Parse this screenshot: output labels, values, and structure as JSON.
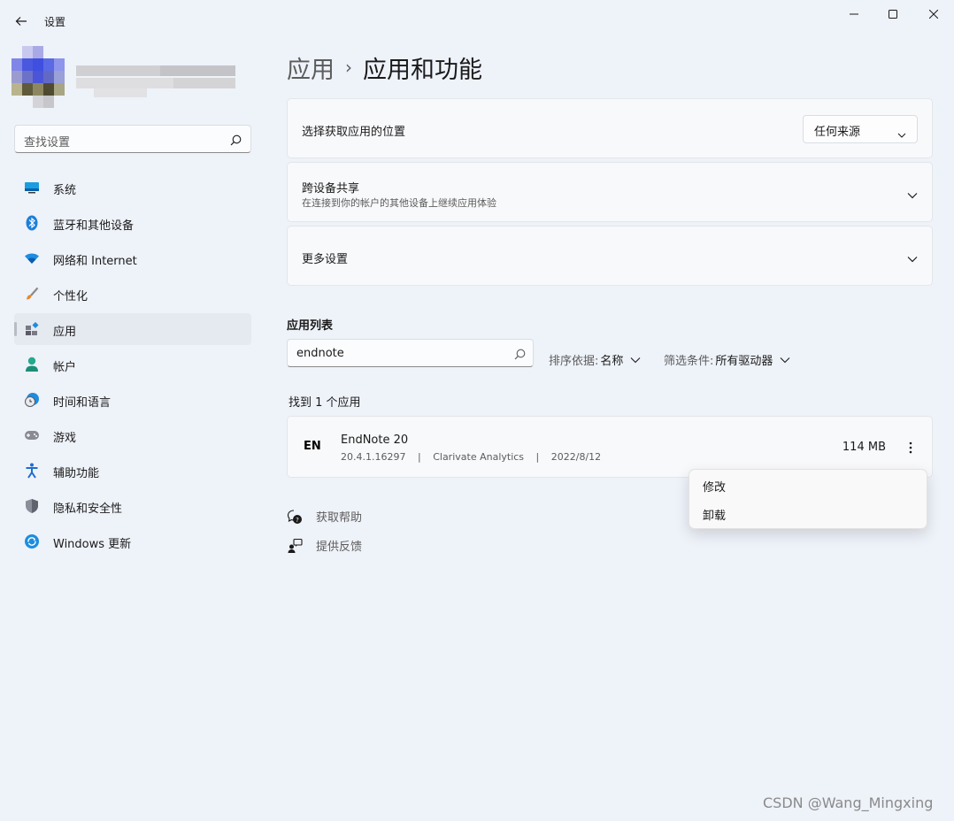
{
  "window": {
    "title": "设置"
  },
  "sidebar": {
    "search_placeholder": "查找设置",
    "items": [
      {
        "label": "系统",
        "icon": "system-icon"
      },
      {
        "label": "蓝牙和其他设备",
        "icon": "bluetooth-icon"
      },
      {
        "label": "网络和 Internet",
        "icon": "wifi-icon"
      },
      {
        "label": "个性化",
        "icon": "brush-icon"
      },
      {
        "label": "应用",
        "icon": "apps-icon",
        "active": true
      },
      {
        "label": "帐户",
        "icon": "account-icon"
      },
      {
        "label": "时间和语言",
        "icon": "clock-globe-icon"
      },
      {
        "label": "游戏",
        "icon": "gamepad-icon"
      },
      {
        "label": "辅助功能",
        "icon": "accessibility-icon"
      },
      {
        "label": "隐私和安全性",
        "icon": "shield-icon"
      },
      {
        "label": "Windows 更新",
        "icon": "update-icon"
      }
    ]
  },
  "breadcrumb": {
    "parent": "应用",
    "separator": "›",
    "current": "应用和功能"
  },
  "cards": {
    "install_source": {
      "title": "选择获取应用的位置",
      "dropdown_value": "任何来源"
    },
    "cross_device": {
      "title": "跨设备共享",
      "subtitle": "在连接到你的帐户的其他设备上继续应用体验"
    },
    "more_settings": {
      "title": "更多设置"
    }
  },
  "app_list": {
    "section_title": "应用列表",
    "search_value": "endnote",
    "sort_label": "排序依据:",
    "sort_value": "名称",
    "filter_label": "筛选条件:",
    "filter_value": "所有驱动器",
    "found_text": "找到 1 个应用",
    "apps": [
      {
        "logo": "EN",
        "name": "EndNote 20",
        "version": "20.4.1.16297",
        "publisher": "Clarivate Analytics",
        "date": "2022/8/12",
        "meta_sep": "|",
        "size": "114 MB"
      }
    ]
  },
  "context_menu": {
    "items": [
      "修改",
      "卸载"
    ]
  },
  "footer": {
    "help": "获取帮助",
    "feedback": "提供反馈"
  },
  "watermark": "CSDN @Wang_Mingxing",
  "colors": {
    "background": "#eef2f9",
    "card": "#f8f9fb",
    "accent": "#0067c0"
  }
}
